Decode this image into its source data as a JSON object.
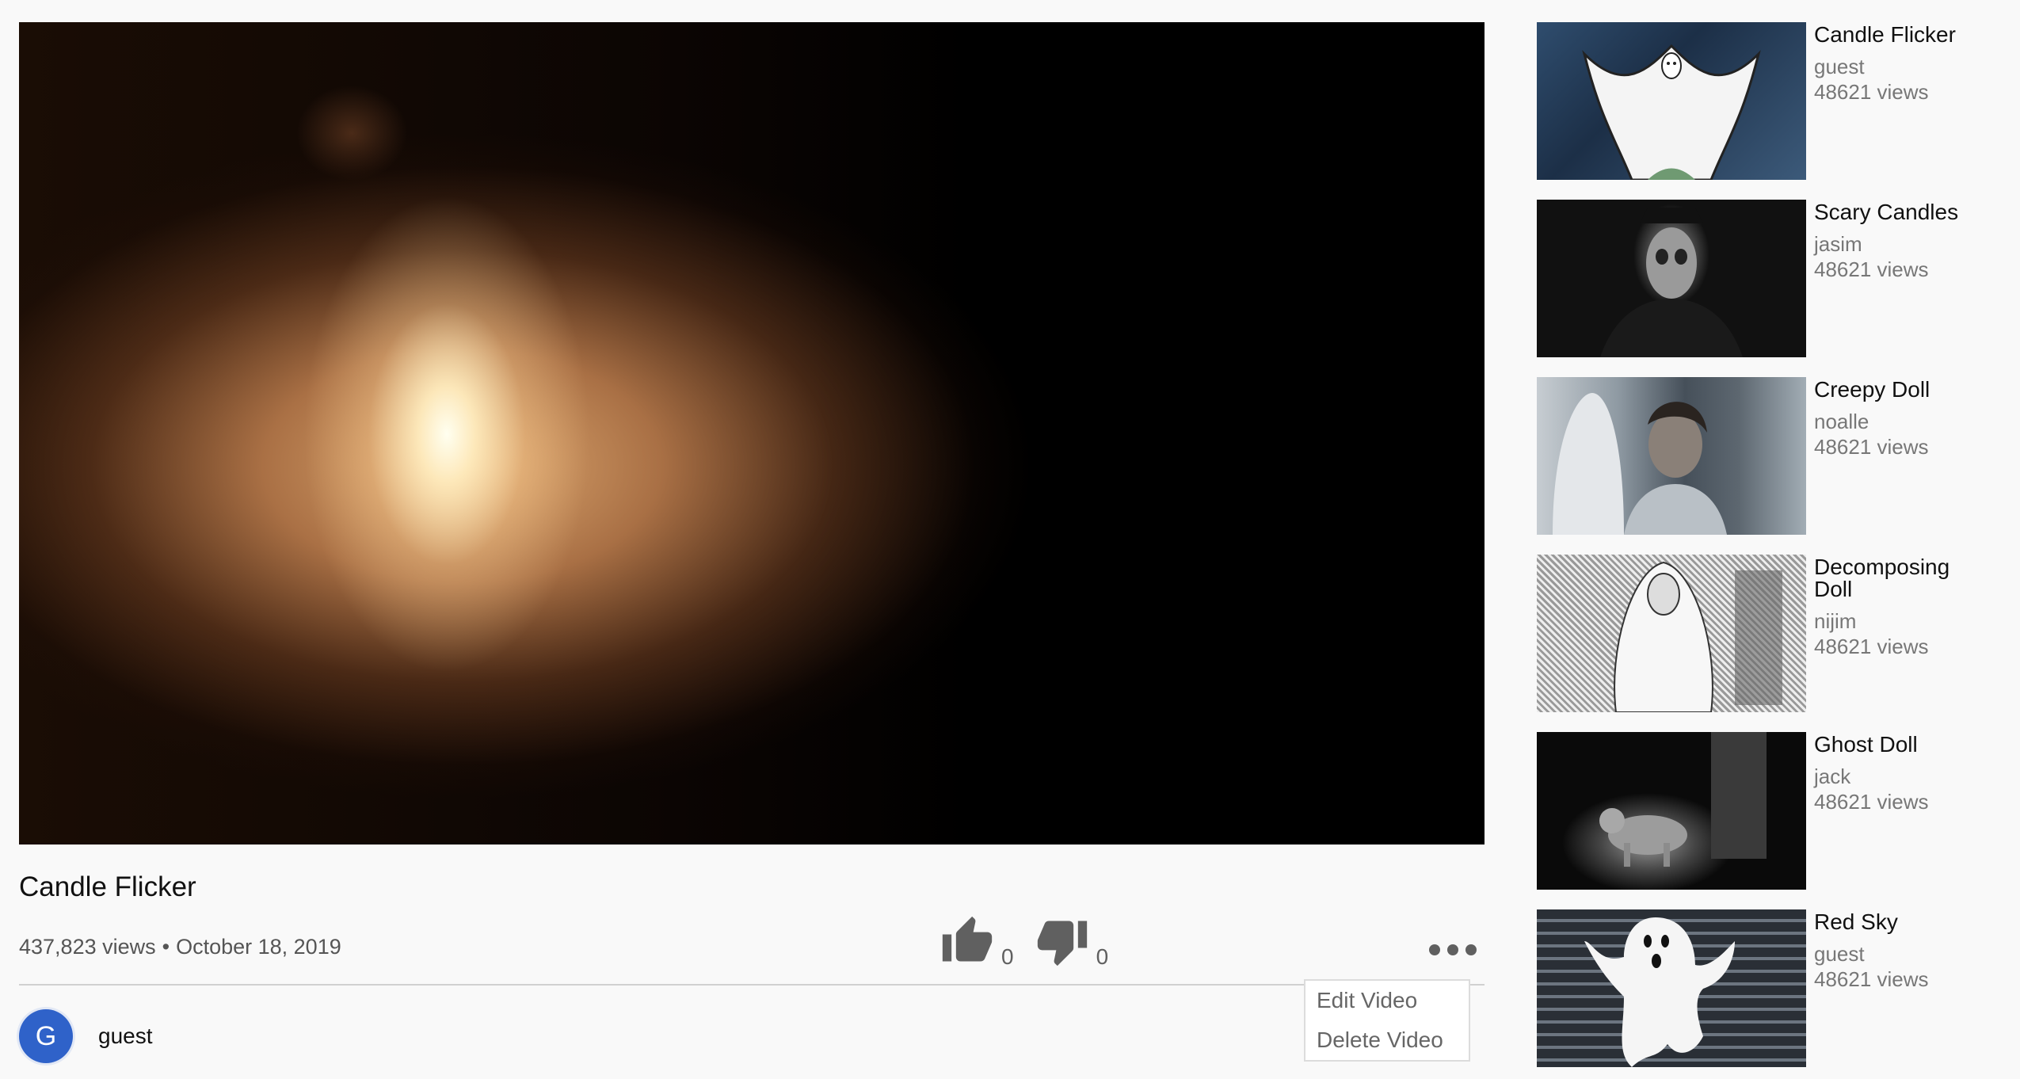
{
  "video": {
    "title": "Candle Flicker",
    "views": "437,823 views",
    "separator": "•",
    "date": "October 18, 2019",
    "likes": "0",
    "dislikes": "0",
    "author_initial": "G",
    "author": "guest"
  },
  "menu": {
    "edit": "Edit Video",
    "delete": "Delete Video"
  },
  "icons": {
    "like": "thumbs-up-icon",
    "dislike": "thumbs-down-icon",
    "more": "more-horizontal-icon"
  },
  "colors": {
    "avatar": "#2f62c9",
    "icon_gray": "#606060"
  },
  "sidebar": {
    "items": [
      {
        "title": "Candle Flicker",
        "author": "guest",
        "views": "48621 views"
      },
      {
        "title": "Scary Candles",
        "author": "jasim",
        "views": "48621 views"
      },
      {
        "title": "Creepy Doll",
        "author": "noalle",
        "views": "48621 views"
      },
      {
        "title": "Decomposing Doll",
        "author": "nijim",
        "views": "48621 views"
      },
      {
        "title": "Ghost Doll",
        "author": "jack",
        "views": "48621 views"
      },
      {
        "title": "Red Sky",
        "author": "guest",
        "views": "48621 views"
      }
    ]
  }
}
